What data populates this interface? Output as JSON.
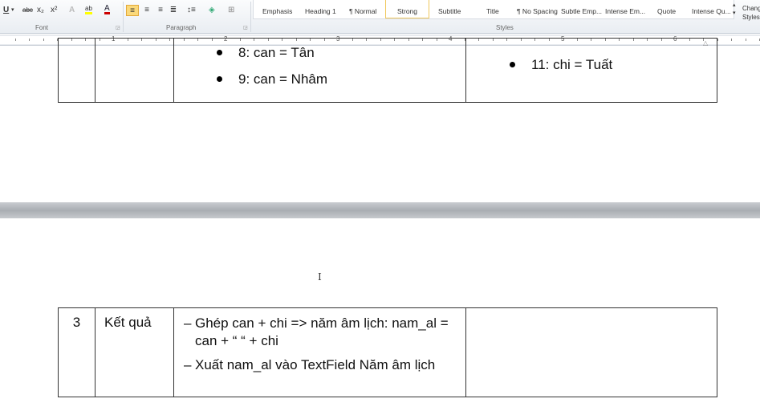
{
  "ribbon": {
    "font_group": "Font",
    "paragraph_group": "Paragraph",
    "styles_group": "Styles",
    "font_buttons": [
      {
        "name": "underline",
        "glyph": "U"
      },
      {
        "name": "strikethrough",
        "glyph": "abc"
      },
      {
        "name": "subscript",
        "glyph": "x₂"
      },
      {
        "name": "superscript",
        "glyph": "x²"
      },
      {
        "name": "text-effects",
        "glyph": "A"
      },
      {
        "name": "highlight",
        "glyph": "ab"
      },
      {
        "name": "font-color",
        "glyph": "A"
      }
    ],
    "highlight_color": "#ffff00",
    "font_color": "#cc0000",
    "styles": [
      "Emphasis",
      "Heading 1",
      "¶ Normal",
      "Strong",
      "Subtitle",
      "Title",
      "¶ No Spacing",
      "Subtle Emp...",
      "Intense Em...",
      "Quote",
      "Intense Qu..."
    ],
    "selected_style": "Strong",
    "change_styles": "Change Styles"
  },
  "ruler": {
    "numbers": [
      "1",
      "2",
      "3",
      "4",
      "5",
      "6"
    ]
  },
  "table1": {
    "col3_items": [
      "8: can = Tân",
      "9: can = Nhâm"
    ],
    "col4_items": [
      "11: chi = Tuất"
    ]
  },
  "table2": {
    "number": "3",
    "title": "Kết quả",
    "steps": [
      "Ghép can + chi => năm âm lịch: nam_al = can + “ “ + chi",
      "Xuất nam_al vào TextField Năm âm lịch"
    ],
    "notes": ""
  }
}
